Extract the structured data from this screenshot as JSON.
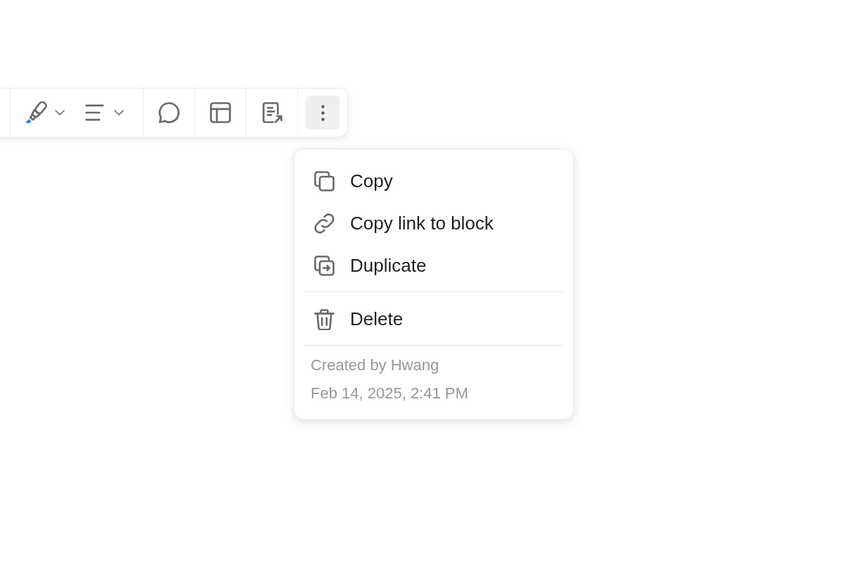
{
  "toolbar": {
    "groups": [
      {
        "buttons": [
          {
            "kind": "highlighter",
            "dropdown": true,
            "selected": false
          },
          {
            "kind": "align",
            "dropdown": true,
            "selected": false
          }
        ]
      },
      {
        "buttons": [
          {
            "kind": "comment",
            "dropdown": false,
            "selected": false
          }
        ]
      },
      {
        "buttons": [
          {
            "kind": "layout",
            "dropdown": false,
            "selected": false
          }
        ]
      },
      {
        "buttons": [
          {
            "kind": "export",
            "dropdown": false,
            "selected": false
          }
        ]
      },
      {
        "buttons": [
          {
            "kind": "more",
            "dropdown": false,
            "selected": true
          }
        ]
      }
    ]
  },
  "menu": {
    "groups": [
      {
        "items": [
          {
            "kind": "copy",
            "label": "Copy"
          },
          {
            "kind": "link",
            "label": "Copy link to block"
          },
          {
            "kind": "duplicate",
            "label": "Duplicate"
          }
        ]
      },
      {
        "items": [
          {
            "kind": "delete",
            "label": "Delete"
          }
        ]
      }
    ],
    "footer": {
      "created_by": "Created by Hwang",
      "timestamp": "Feb 14, 2025, 2:41 PM"
    }
  }
}
